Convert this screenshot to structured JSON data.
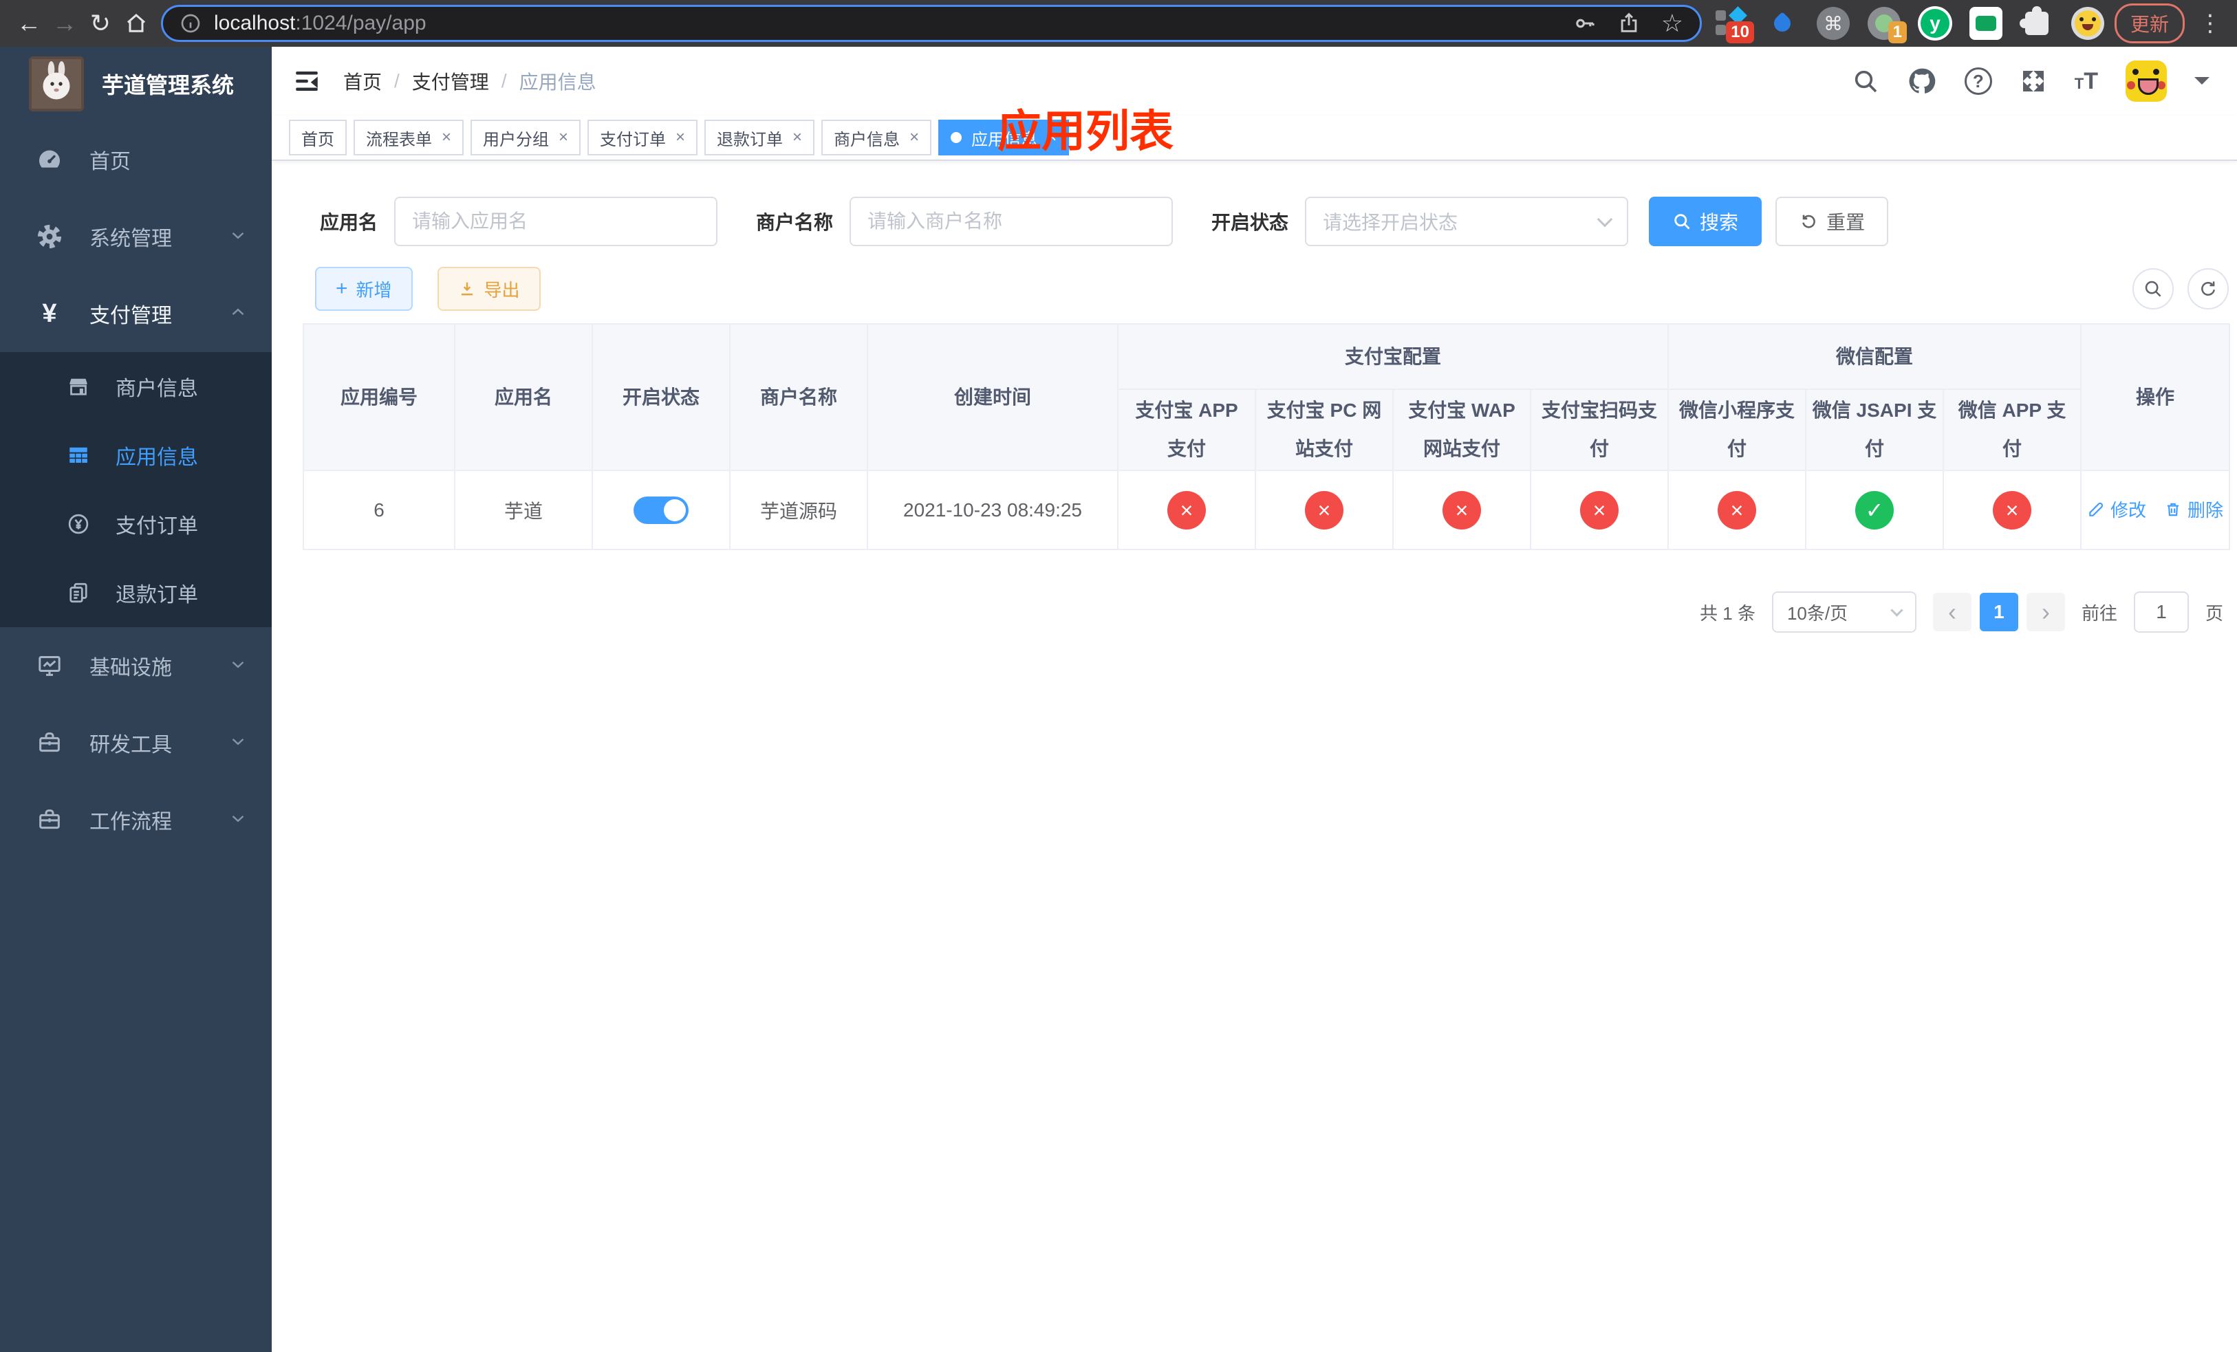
{
  "browser": {
    "url": {
      "host": "localhost",
      "path": ":1024/pay/app"
    },
    "update_label": "更新",
    "extension_badge": "10",
    "profile_badge": "1",
    "yuque_letter": "y"
  },
  "icons": {
    "back": "←",
    "forward": "→",
    "reload": "↻",
    "bookmark_star": "☆",
    "command": "⌘",
    "menu_dots": "⋮",
    "yen": "¥",
    "plus": "+",
    "question": "?",
    "prev": "‹",
    "next": "›"
  },
  "sidebar": {
    "title": "芋道管理系统",
    "items": [
      {
        "label": "首页"
      },
      {
        "label": "系统管理",
        "expandable": true
      },
      {
        "label": "支付管理",
        "expandable": true,
        "expanded": true,
        "children": [
          {
            "label": "商户信息"
          },
          {
            "label": "应用信息",
            "active": true
          },
          {
            "label": "支付订单"
          },
          {
            "label": "退款订单"
          }
        ]
      },
      {
        "label": "基础设施",
        "expandable": true
      },
      {
        "label": "研发工具",
        "expandable": true
      },
      {
        "label": "工作流程",
        "expandable": true
      }
    ]
  },
  "navbar": {
    "breadcrumb": [
      "首页",
      "支付管理",
      "应用信息"
    ]
  },
  "annotation": "应用列表",
  "tags": [
    {
      "label": "首页",
      "closable": false,
      "active": false
    },
    {
      "label": "流程表单",
      "closable": true,
      "active": false
    },
    {
      "label": "用户分组",
      "closable": true,
      "active": false
    },
    {
      "label": "支付订单",
      "closable": true,
      "active": false
    },
    {
      "label": "退款订单",
      "closable": true,
      "active": false
    },
    {
      "label": "商户信息",
      "closable": true,
      "active": false
    },
    {
      "label": "应用信息",
      "closable": true,
      "active": true
    }
  ],
  "tag_close_glyph": "×",
  "filters": {
    "app_name_label": "应用名",
    "app_name_placeholder": "请输入应用名",
    "merchant_label": "商户名称",
    "merchant_placeholder": "请输入商户名称",
    "status_label": "开启状态",
    "status_placeholder": "请选择开启状态",
    "search": "搜索",
    "reset": "重置"
  },
  "toolbar": {
    "add": "新增",
    "export": "导出"
  },
  "table": {
    "header": {
      "id": "应用编号",
      "name": "应用名",
      "status": "开启状态",
      "merchant": "商户名称",
      "created": "创建时间",
      "alipay_group": "支付宝配置",
      "wechat_group": "微信配置",
      "actions": "操作",
      "channels": [
        "支付宝 APP 支付",
        "支付宝 PC 网站支付",
        "支付宝 WAP 网站支付",
        "支付宝扫码支付",
        "微信小程序支付",
        "微信 JSAPI 支付",
        "微信 APP 支付"
      ]
    },
    "rows": [
      {
        "id": "6",
        "name": "芋道",
        "enabled": true,
        "merchant": "芋道源码",
        "created": "2021-10-23 08:49:25",
        "channels": [
          {
            "enabled": false,
            "glyph": "×"
          },
          {
            "enabled": false,
            "glyph": "×"
          },
          {
            "enabled": false,
            "glyph": "×"
          },
          {
            "enabled": false,
            "glyph": "×"
          },
          {
            "enabled": false,
            "glyph": "×"
          },
          {
            "enabled": true,
            "glyph": "✓"
          },
          {
            "enabled": false,
            "glyph": "×"
          }
        ],
        "actions": {
          "edit": "修改",
          "delete": "删除"
        }
      }
    ]
  },
  "pagination": {
    "total": "共 1 条",
    "page_size": "10条/页",
    "page": "1",
    "goto": "前往",
    "goto_value": "1",
    "unit": "页"
  }
}
